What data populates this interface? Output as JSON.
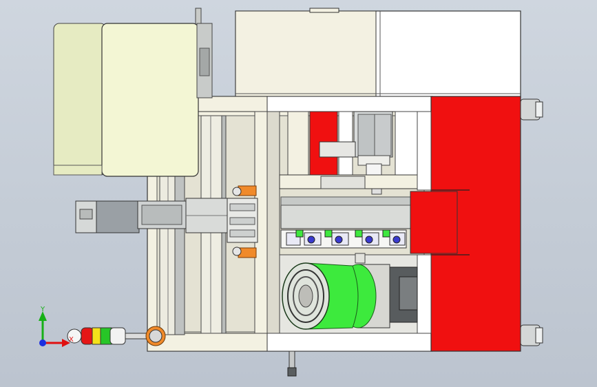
{
  "viewport": {
    "kind": "cad-3d-model-view",
    "background": "gradient-light-blue-grey"
  },
  "triad": {
    "x_label": "X",
    "y_label": "Y",
    "colors": {
      "x": "#e01010",
      "y": "#16b016",
      "z": "#1a2fe0"
    }
  },
  "palette": {
    "frame": "#f3f1e2",
    "panel": "#f2f5d2",
    "guard": "#ffffff",
    "accent_red": "#f01010",
    "roller_green": "#3dea3d",
    "orange": "#f08a2a",
    "steel": "#9aa0a6"
  },
  "signal_tower": {
    "lamps": [
      "red",
      "yellow",
      "green",
      "white"
    ],
    "lamp_colors": [
      "#e51616",
      "#f4e21a",
      "#27c627",
      "#f2f2f2"
    ]
  },
  "icons": [
    "axis-triad-icon",
    "signal-tower-icon"
  ]
}
